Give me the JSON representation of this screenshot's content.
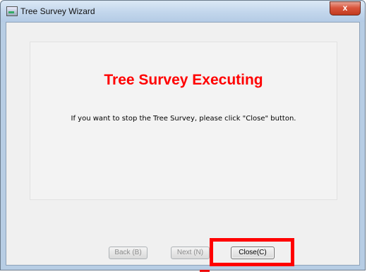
{
  "window": {
    "title": "Tree Survey Wizard",
    "close_glyph": "x"
  },
  "content": {
    "headline": "Tree Survey Executing",
    "message": "If you want to stop the Tree Survey, please click \"Close\" button."
  },
  "buttons": {
    "back": "Back (B)",
    "next": "Next (N)",
    "close": "Close(C)"
  },
  "colors": {
    "headline": "#ff0000",
    "highlight": "#ff0000"
  }
}
